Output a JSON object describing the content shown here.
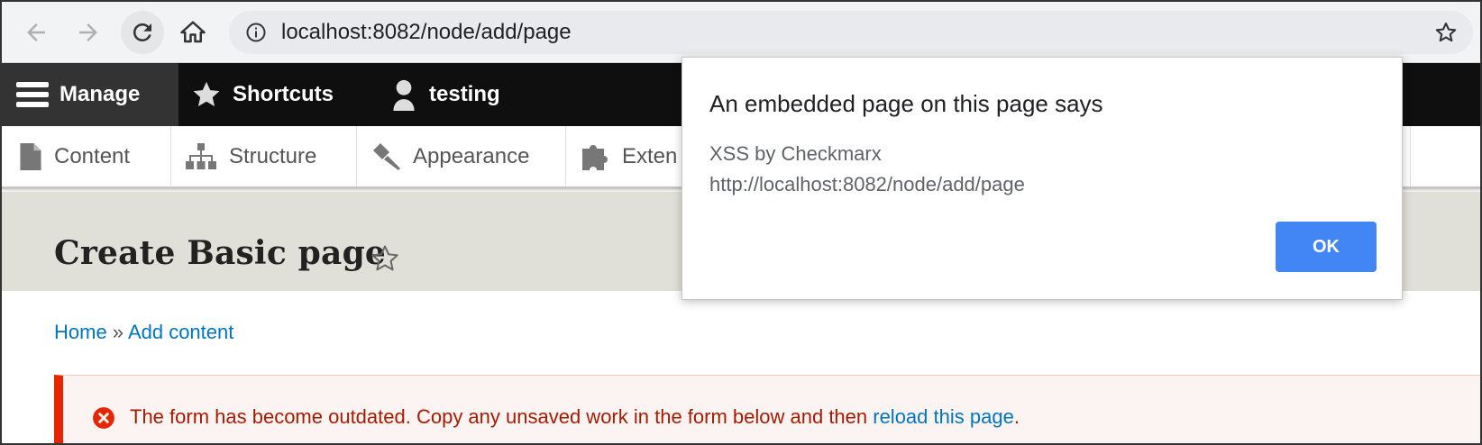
{
  "browser": {
    "url": "localhost:8082/node/add/page"
  },
  "admin_toolbar": {
    "manage_label": "Manage",
    "shortcuts_label": "Shortcuts",
    "user_label": "testing"
  },
  "tray": {
    "items": [
      {
        "label": "Content",
        "icon": "file-icon"
      },
      {
        "label": "Structure",
        "icon": "sitemap-icon"
      },
      {
        "label": "Appearance",
        "icon": "paintbrush-icon"
      },
      {
        "label": "Exten",
        "icon": "puzzle-icon"
      }
    ]
  },
  "page": {
    "title": "Create Basic page"
  },
  "breadcrumb": {
    "home": "Home",
    "separator": " » ",
    "add_content": "Add content"
  },
  "message": {
    "text": "The form has become outdated. Copy any unsaved work in the form below and then ",
    "link": "reload this page",
    "end": "."
  },
  "dialog": {
    "title": "An embedded page on this page says",
    "message": "XSS by Checkmarx",
    "url": "http://localhost:8082/node/add/page",
    "ok_label": "OK"
  },
  "colors": {
    "accent": "#4285f4",
    "link": "#0074bd",
    "error": "#e62600"
  }
}
